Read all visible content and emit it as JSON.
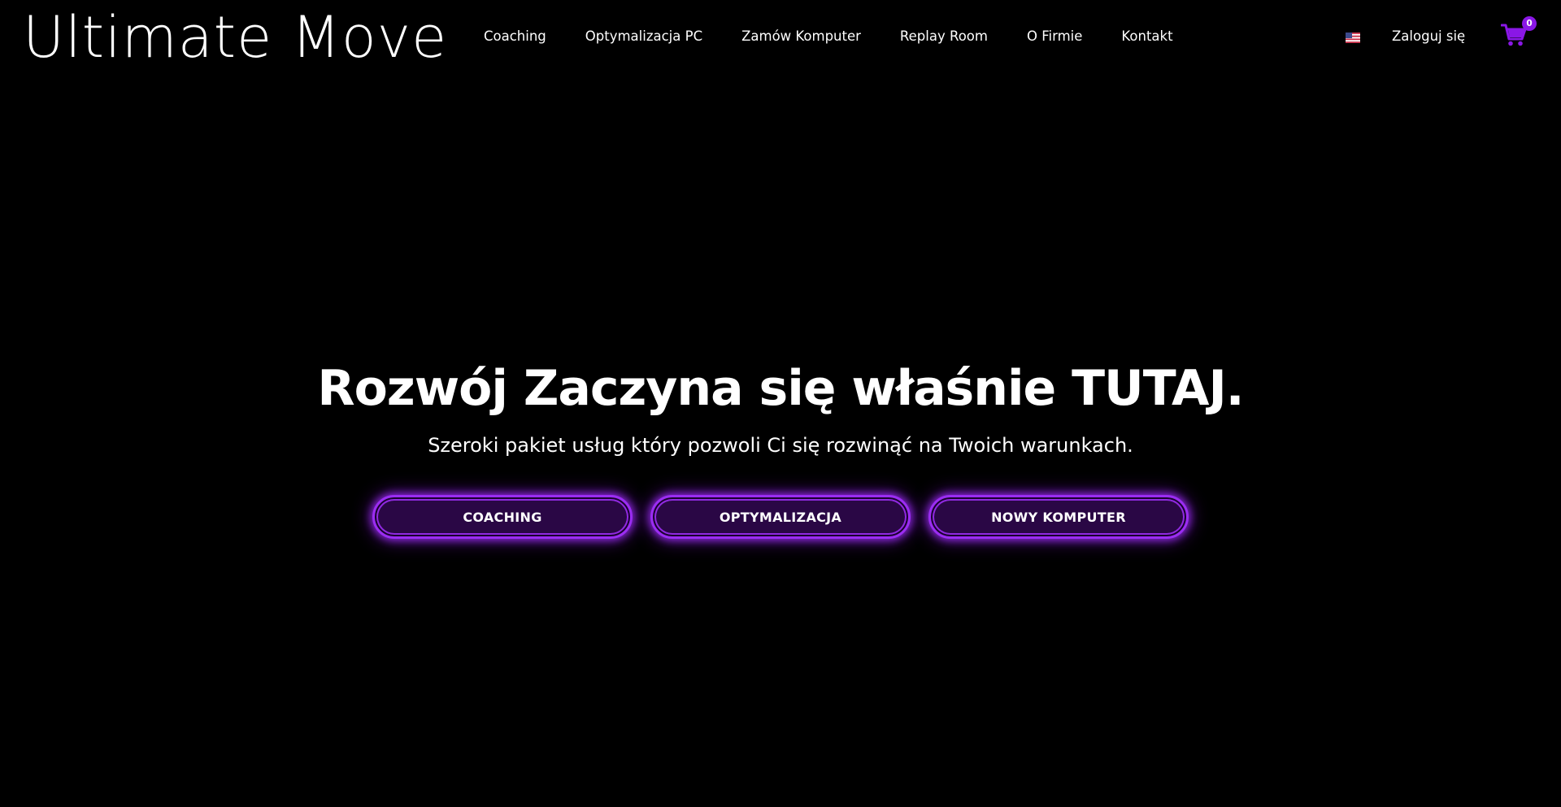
{
  "brand": {
    "logo_text": "Ultimate Move",
    "accent_color": "#8a17e6",
    "background_color": "#000000"
  },
  "nav": {
    "items": [
      {
        "label": "Coaching"
      },
      {
        "label": "Optymalizacja PC"
      },
      {
        "label": "Zamów Komputer"
      },
      {
        "label": "Replay Room"
      },
      {
        "label": "O Firmie"
      },
      {
        "label": "Kontakt"
      }
    ]
  },
  "header_actions": {
    "language_icon": "us-flag-icon",
    "login_label": "Zaloguj się",
    "cart_icon": "shopping-cart-icon",
    "cart_count": "0"
  },
  "hero": {
    "title": "Rozwój Zaczyna się właśnie TUTAJ.",
    "subtitle": "Szeroki pakiet usług który pozwoli Ci się rozwinąć na Twoich warunkach.",
    "buttons": [
      {
        "label": "COACHING"
      },
      {
        "label": "OPTYMALIZACJA"
      },
      {
        "label": "NOWY KOMPUTER"
      }
    ]
  }
}
